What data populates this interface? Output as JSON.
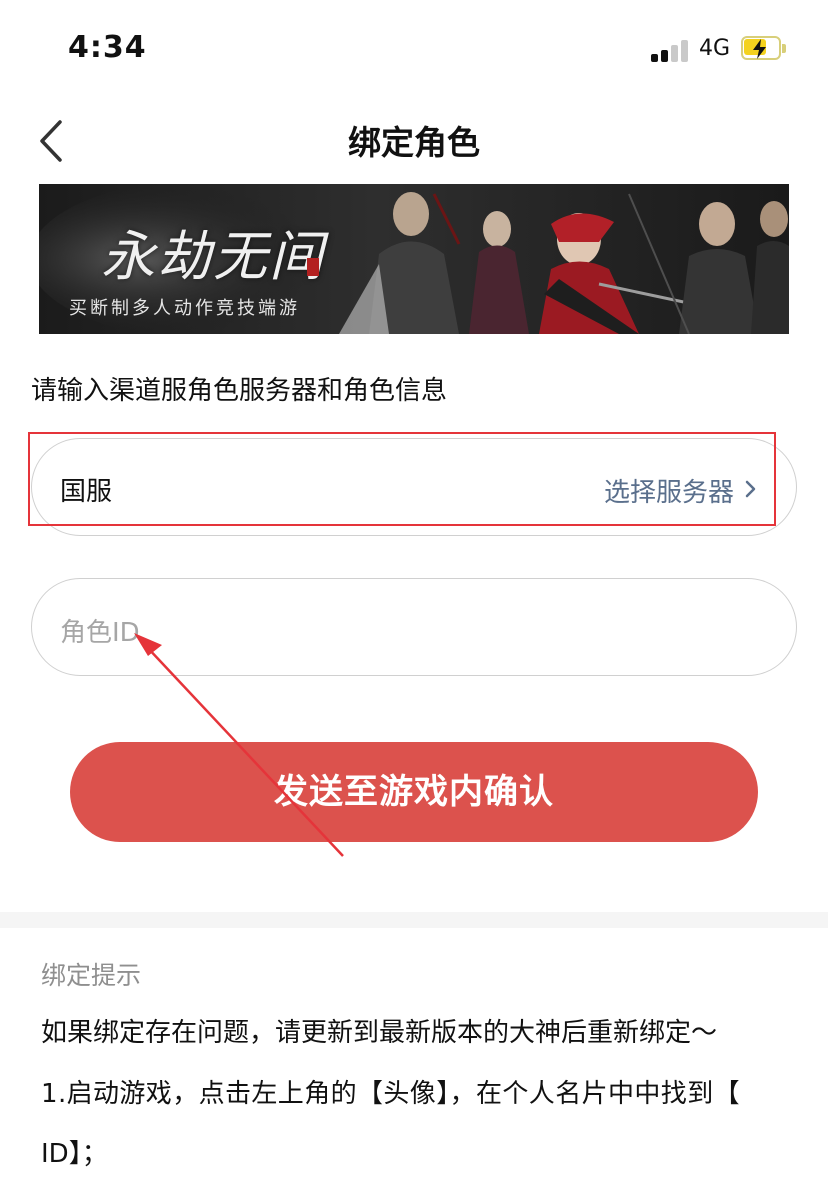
{
  "status_bar": {
    "time": "4:34",
    "network": "4G",
    "signal_bars_active": 2,
    "signal_bars_total": 4,
    "battery": "charging"
  },
  "nav": {
    "back_icon": "chevron-left-icon",
    "title": "绑定角色"
  },
  "banner": {
    "logo_text": "永劫无间",
    "tagline": "买断制多人动作竞技端游"
  },
  "form": {
    "instruction": "请输入渠道服角色服务器和角色信息",
    "server_field": {
      "value": "国服",
      "action_label": "选择服务器",
      "action_icon": "chevron-right-icon"
    },
    "role_field": {
      "placeholder": "角色ID",
      "value": ""
    },
    "submit_label": "发送至游戏内确认"
  },
  "tips": {
    "title": "绑定提示",
    "lines": [
      "如果绑定存在问题，请更新到最新版本的大神后重新绑定～",
      "1.启动游戏，点击左上角的【头像】，在个人名片中中找到【",
      "ID】；"
    ]
  },
  "colors": {
    "primary": "#dc524d",
    "link": "#5a6f8c",
    "annotation": "#e5343a",
    "placeholder": "#a6a6a6"
  }
}
